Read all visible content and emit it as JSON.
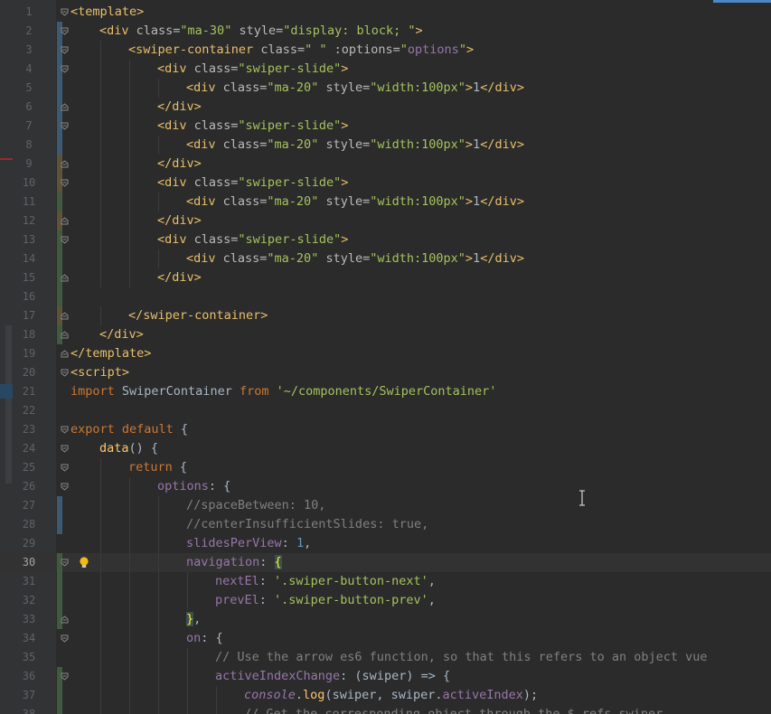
{
  "editor": {
    "current_line": 30,
    "lines": [
      {
        "num": "1",
        "vcs": "",
        "fold": "open",
        "bulb": false,
        "current": false,
        "indent": 0,
        "tokens": [
          {
            "c": "tag",
            "t": "<template>"
          }
        ]
      },
      {
        "num": "2",
        "vcs": "blue",
        "fold": "open",
        "bulb": false,
        "current": false,
        "indent": 1,
        "tokens": [
          {
            "c": "tag",
            "t": "<div "
          },
          {
            "c": "attr",
            "t": "class="
          },
          {
            "c": "str",
            "t": "\"ma-30\""
          },
          {
            "c": "attr",
            "t": " style="
          },
          {
            "c": "str",
            "t": "\"display: block; \""
          },
          {
            "c": "tag",
            "t": ">"
          }
        ]
      },
      {
        "num": "3",
        "vcs": "blue",
        "fold": "open",
        "bulb": false,
        "current": false,
        "indent": 2,
        "tokens": [
          {
            "c": "tag",
            "t": "<swiper-container "
          },
          {
            "c": "attr",
            "t": "class="
          },
          {
            "c": "str",
            "t": "\" \""
          },
          {
            "c": "attr",
            "t": " :options="
          },
          {
            "c": "str",
            "t": "\""
          },
          {
            "c": "prop",
            "t": "options"
          },
          {
            "c": "str",
            "t": "\""
          },
          {
            "c": "tag",
            "t": ">"
          }
        ]
      },
      {
        "num": "4",
        "vcs": "blue",
        "fold": "open",
        "bulb": false,
        "current": false,
        "indent": 3,
        "tokens": [
          {
            "c": "tag",
            "t": "<div "
          },
          {
            "c": "attr",
            "t": "class="
          },
          {
            "c": "str",
            "t": "\"swiper-slide\""
          },
          {
            "c": "tag",
            "t": ">"
          }
        ]
      },
      {
        "num": "5",
        "vcs": "blue",
        "fold": "",
        "bulb": false,
        "current": false,
        "indent": 4,
        "tokens": [
          {
            "c": "tag",
            "t": "<div "
          },
          {
            "c": "attr",
            "t": "class="
          },
          {
            "c": "str",
            "t": "\"ma-20\""
          },
          {
            "c": "attr",
            "t": " style="
          },
          {
            "c": "str",
            "t": "\"width:100px\""
          },
          {
            "c": "tag",
            "t": ">"
          },
          {
            "c": "def",
            "t": "1"
          },
          {
            "c": "tag",
            "t": "</div>"
          }
        ]
      },
      {
        "num": "6",
        "vcs": "blue",
        "fold": "close",
        "bulb": false,
        "current": false,
        "indent": 3,
        "tokens": [
          {
            "c": "tag",
            "t": "</div>"
          }
        ]
      },
      {
        "num": "7",
        "vcs": "blue",
        "fold": "open",
        "bulb": false,
        "current": false,
        "indent": 3,
        "tokens": [
          {
            "c": "tag",
            "t": "<div "
          },
          {
            "c": "attr",
            "t": "class="
          },
          {
            "c": "str",
            "t": "\"swiper-slide\""
          },
          {
            "c": "tag",
            "t": ">"
          }
        ]
      },
      {
        "num": "8",
        "vcs": "blue",
        "fold": "",
        "bulb": false,
        "current": false,
        "indent": 4,
        "tokens": [
          {
            "c": "tag",
            "t": "<div "
          },
          {
            "c": "attr",
            "t": "class="
          },
          {
            "c": "str",
            "t": "\"ma-20\""
          },
          {
            "c": "attr",
            "t": " style="
          },
          {
            "c": "str",
            "t": "\"width:100px\""
          },
          {
            "c": "tag",
            "t": ">"
          },
          {
            "c": "def",
            "t": "1"
          },
          {
            "c": "tag",
            "t": "</div>"
          }
        ]
      },
      {
        "num": "9",
        "vcs": "brown",
        "fold": "close",
        "bulb": false,
        "current": false,
        "indent": 3,
        "tokens": [
          {
            "c": "tag",
            "t": "</div>"
          }
        ]
      },
      {
        "num": "10",
        "vcs": "brown",
        "fold": "open",
        "bulb": false,
        "current": false,
        "indent": 3,
        "tokens": [
          {
            "c": "tag",
            "t": "<div "
          },
          {
            "c": "attr",
            "t": "class="
          },
          {
            "c": "str",
            "t": "\"swiper-slide\""
          },
          {
            "c": "tag",
            "t": ">"
          }
        ]
      },
      {
        "num": "11",
        "vcs": "green",
        "fold": "",
        "bulb": false,
        "current": false,
        "indent": 4,
        "tokens": [
          {
            "c": "tag",
            "t": "<div "
          },
          {
            "c": "attr",
            "t": "class="
          },
          {
            "c": "str",
            "t": "\"ma-20\""
          },
          {
            "c": "attr",
            "t": " style="
          },
          {
            "c": "str",
            "t": "\"width:100px\""
          },
          {
            "c": "tag",
            "t": ">"
          },
          {
            "c": "def",
            "t": "1"
          },
          {
            "c": "tag",
            "t": "</div>"
          }
        ]
      },
      {
        "num": "12",
        "vcs": "brown",
        "fold": "close",
        "bulb": false,
        "current": false,
        "indent": 3,
        "tokens": [
          {
            "c": "tag",
            "t": "</div>"
          }
        ]
      },
      {
        "num": "13",
        "vcs": "green",
        "fold": "open",
        "bulb": false,
        "current": false,
        "indent": 3,
        "tokens": [
          {
            "c": "tag",
            "t": "<div "
          },
          {
            "c": "attr",
            "t": "class="
          },
          {
            "c": "str",
            "t": "\"swiper-slide\""
          },
          {
            "c": "tag",
            "t": ">"
          }
        ]
      },
      {
        "num": "14",
        "vcs": "green",
        "fold": "",
        "bulb": false,
        "current": false,
        "indent": 4,
        "tokens": [
          {
            "c": "tag",
            "t": "<div "
          },
          {
            "c": "attr",
            "t": "class="
          },
          {
            "c": "str",
            "t": "\"ma-20\""
          },
          {
            "c": "attr",
            "t": " style="
          },
          {
            "c": "str",
            "t": "\"width:100px\""
          },
          {
            "c": "tag",
            "t": ">"
          },
          {
            "c": "def",
            "t": "1"
          },
          {
            "c": "tag",
            "t": "</div>"
          }
        ]
      },
      {
        "num": "15",
        "vcs": "green",
        "fold": "close",
        "bulb": false,
        "current": false,
        "indent": 3,
        "tokens": [
          {
            "c": "tag",
            "t": "</div>"
          }
        ]
      },
      {
        "num": "16",
        "vcs": "green",
        "fold": "",
        "bulb": false,
        "current": false,
        "indent": 0,
        "tokens": []
      },
      {
        "num": "17",
        "vcs": "brown",
        "fold": "close",
        "bulb": false,
        "current": false,
        "indent": 2,
        "tokens": [
          {
            "c": "tag",
            "t": "</swiper-container>"
          }
        ]
      },
      {
        "num": "18",
        "vcs": "green",
        "fold": "close",
        "bulb": false,
        "current": false,
        "indent": 1,
        "tokens": [
          {
            "c": "tag",
            "t": "</div>"
          }
        ]
      },
      {
        "num": "19",
        "vcs": "",
        "fold": "close",
        "bulb": false,
        "current": false,
        "indent": 0,
        "tokens": [
          {
            "c": "tag",
            "t": "</template>"
          }
        ]
      },
      {
        "num": "20",
        "vcs": "",
        "fold": "open",
        "bulb": false,
        "current": false,
        "indent": 0,
        "tokens": [
          {
            "c": "tag",
            "t": "<script>"
          }
        ]
      },
      {
        "num": "21",
        "vcs": "",
        "fold": "",
        "bulb": false,
        "current": false,
        "indent": 0,
        "tokens": [
          {
            "c": "kw",
            "t": "import "
          },
          {
            "c": "def",
            "t": "SwiperContainer "
          },
          {
            "c": "kw",
            "t": "from "
          },
          {
            "c": "str",
            "t": "'~/components/SwiperContainer'"
          }
        ]
      },
      {
        "num": "22",
        "vcs": "",
        "fold": "",
        "bulb": false,
        "current": false,
        "indent": 0,
        "tokens": []
      },
      {
        "num": "23",
        "vcs": "",
        "fold": "open",
        "bulb": false,
        "current": false,
        "indent": 0,
        "tokens": [
          {
            "c": "kw",
            "t": "export default "
          },
          {
            "c": "def",
            "t": "{"
          }
        ]
      },
      {
        "num": "24",
        "vcs": "",
        "fold": "open",
        "bulb": false,
        "current": false,
        "indent": 1,
        "tokens": [
          {
            "c": "method",
            "t": "data"
          },
          {
            "c": "def",
            "t": "() {"
          }
        ]
      },
      {
        "num": "25",
        "vcs": "",
        "fold": "open",
        "bulb": false,
        "current": false,
        "indent": 2,
        "tokens": [
          {
            "c": "kw",
            "t": "return "
          },
          {
            "c": "def",
            "t": "{"
          }
        ]
      },
      {
        "num": "26",
        "vcs": "",
        "fold": "open",
        "bulb": false,
        "current": false,
        "indent": 3,
        "tokens": [
          {
            "c": "prop",
            "t": "options"
          },
          {
            "c": "def",
            "t": ": {"
          }
        ]
      },
      {
        "num": "27",
        "vcs": "blue",
        "fold": "",
        "bulb": false,
        "current": false,
        "indent": 4,
        "tokens": [
          {
            "c": "cmt",
            "t": "//spaceBetween: 10,"
          }
        ]
      },
      {
        "num": "28",
        "vcs": "blue",
        "fold": "",
        "bulb": false,
        "current": false,
        "indent": 4,
        "tokens": [
          {
            "c": "cmt",
            "t": "//centerInsufficientSlides: true,"
          }
        ]
      },
      {
        "num": "29",
        "vcs": "",
        "fold": "",
        "bulb": false,
        "current": false,
        "indent": 4,
        "tokens": [
          {
            "c": "prop",
            "t": "slidesPerView"
          },
          {
            "c": "def",
            "t": ": "
          },
          {
            "c": "num",
            "t": "1"
          },
          {
            "c": "def",
            "t": ","
          }
        ]
      },
      {
        "num": "30",
        "vcs": "green",
        "fold": "open",
        "bulb": true,
        "current": true,
        "indent": 4,
        "tokens": [
          {
            "c": "prop",
            "t": "navigation"
          },
          {
            "c": "def",
            "t": ": "
          },
          {
            "c": "brace-hl",
            "t": "{"
          }
        ]
      },
      {
        "num": "31",
        "vcs": "green",
        "fold": "",
        "bulb": false,
        "current": false,
        "indent": 5,
        "tokens": [
          {
            "c": "prop",
            "t": "nextEl"
          },
          {
            "c": "def",
            "t": ": "
          },
          {
            "c": "str",
            "t": "'.swiper-button-next'"
          },
          {
            "c": "def",
            "t": ","
          }
        ]
      },
      {
        "num": "32",
        "vcs": "green",
        "fold": "",
        "bulb": false,
        "current": false,
        "indent": 5,
        "tokens": [
          {
            "c": "prop",
            "t": "prevEl"
          },
          {
            "c": "def",
            "t": ": "
          },
          {
            "c": "str",
            "t": "'.swiper-button-prev'"
          },
          {
            "c": "def",
            "t": ","
          }
        ]
      },
      {
        "num": "33",
        "vcs": "green",
        "fold": "close",
        "bulb": false,
        "current": false,
        "indent": 4,
        "tokens": [
          {
            "c": "brace-hl",
            "t": "}"
          },
          {
            "c": "def",
            "t": ","
          }
        ]
      },
      {
        "num": "34",
        "vcs": "",
        "fold": "open",
        "bulb": false,
        "current": false,
        "indent": 4,
        "tokens": [
          {
            "c": "prop",
            "t": "on"
          },
          {
            "c": "def",
            "t": ": {"
          }
        ]
      },
      {
        "num": "35",
        "vcs": "",
        "fold": "",
        "bulb": false,
        "current": false,
        "indent": 5,
        "tokens": [
          {
            "c": "cmt",
            "t": "// Use the arrow es6 function, so that this refers to an object vue"
          }
        ]
      },
      {
        "num": "36",
        "vcs": "green",
        "fold": "open",
        "bulb": false,
        "current": false,
        "indent": 5,
        "tokens": [
          {
            "c": "prop",
            "t": "activeIndexChange"
          },
          {
            "c": "def",
            "t": ": (swiper) => {"
          }
        ]
      },
      {
        "num": "37",
        "vcs": "green",
        "fold": "",
        "bulb": false,
        "current": false,
        "indent": 6,
        "tokens": [
          {
            "c": "ital",
            "t": "console"
          },
          {
            "c": "def",
            "t": "."
          },
          {
            "c": "method",
            "t": "log"
          },
          {
            "c": "def",
            "t": "(swiper, swiper."
          },
          {
            "c": "prop",
            "t": "activeIndex"
          },
          {
            "c": "def",
            "t": ");"
          }
        ]
      },
      {
        "num": "38",
        "vcs": "green",
        "fold": "",
        "bulb": false,
        "current": false,
        "indent": 6,
        "tokens": [
          {
            "c": "cmt",
            "t": "// Get the corresponding object through the $ refs swiper"
          }
        ]
      }
    ]
  }
}
